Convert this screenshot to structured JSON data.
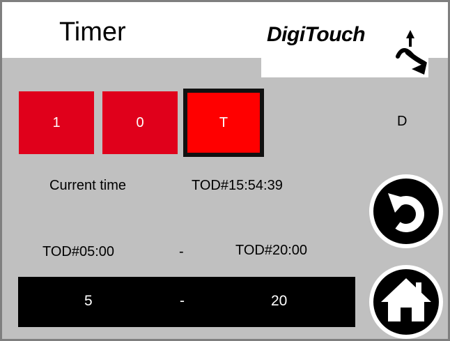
{
  "header": {
    "title": "Timer",
    "logo_text": "DigiTouch"
  },
  "digits": [
    {
      "label": "1"
    },
    {
      "label": "0"
    },
    {
      "label": "T"
    }
  ],
  "side_letter": "D",
  "current_time": {
    "label": "Current time",
    "value": "TOD#15:54:39"
  },
  "range": {
    "start": "TOD#05:00",
    "separator": "-",
    "end": "TOD#20:00"
  },
  "range_hours": {
    "start": "5",
    "separator": "-",
    "end": "20"
  },
  "icons": {
    "back": "undo-arrow-icon",
    "home": "home-icon"
  },
  "colors": {
    "background": "#c0c0c0",
    "digit_red": "#e0001b",
    "digit_active": "#ff0000"
  }
}
